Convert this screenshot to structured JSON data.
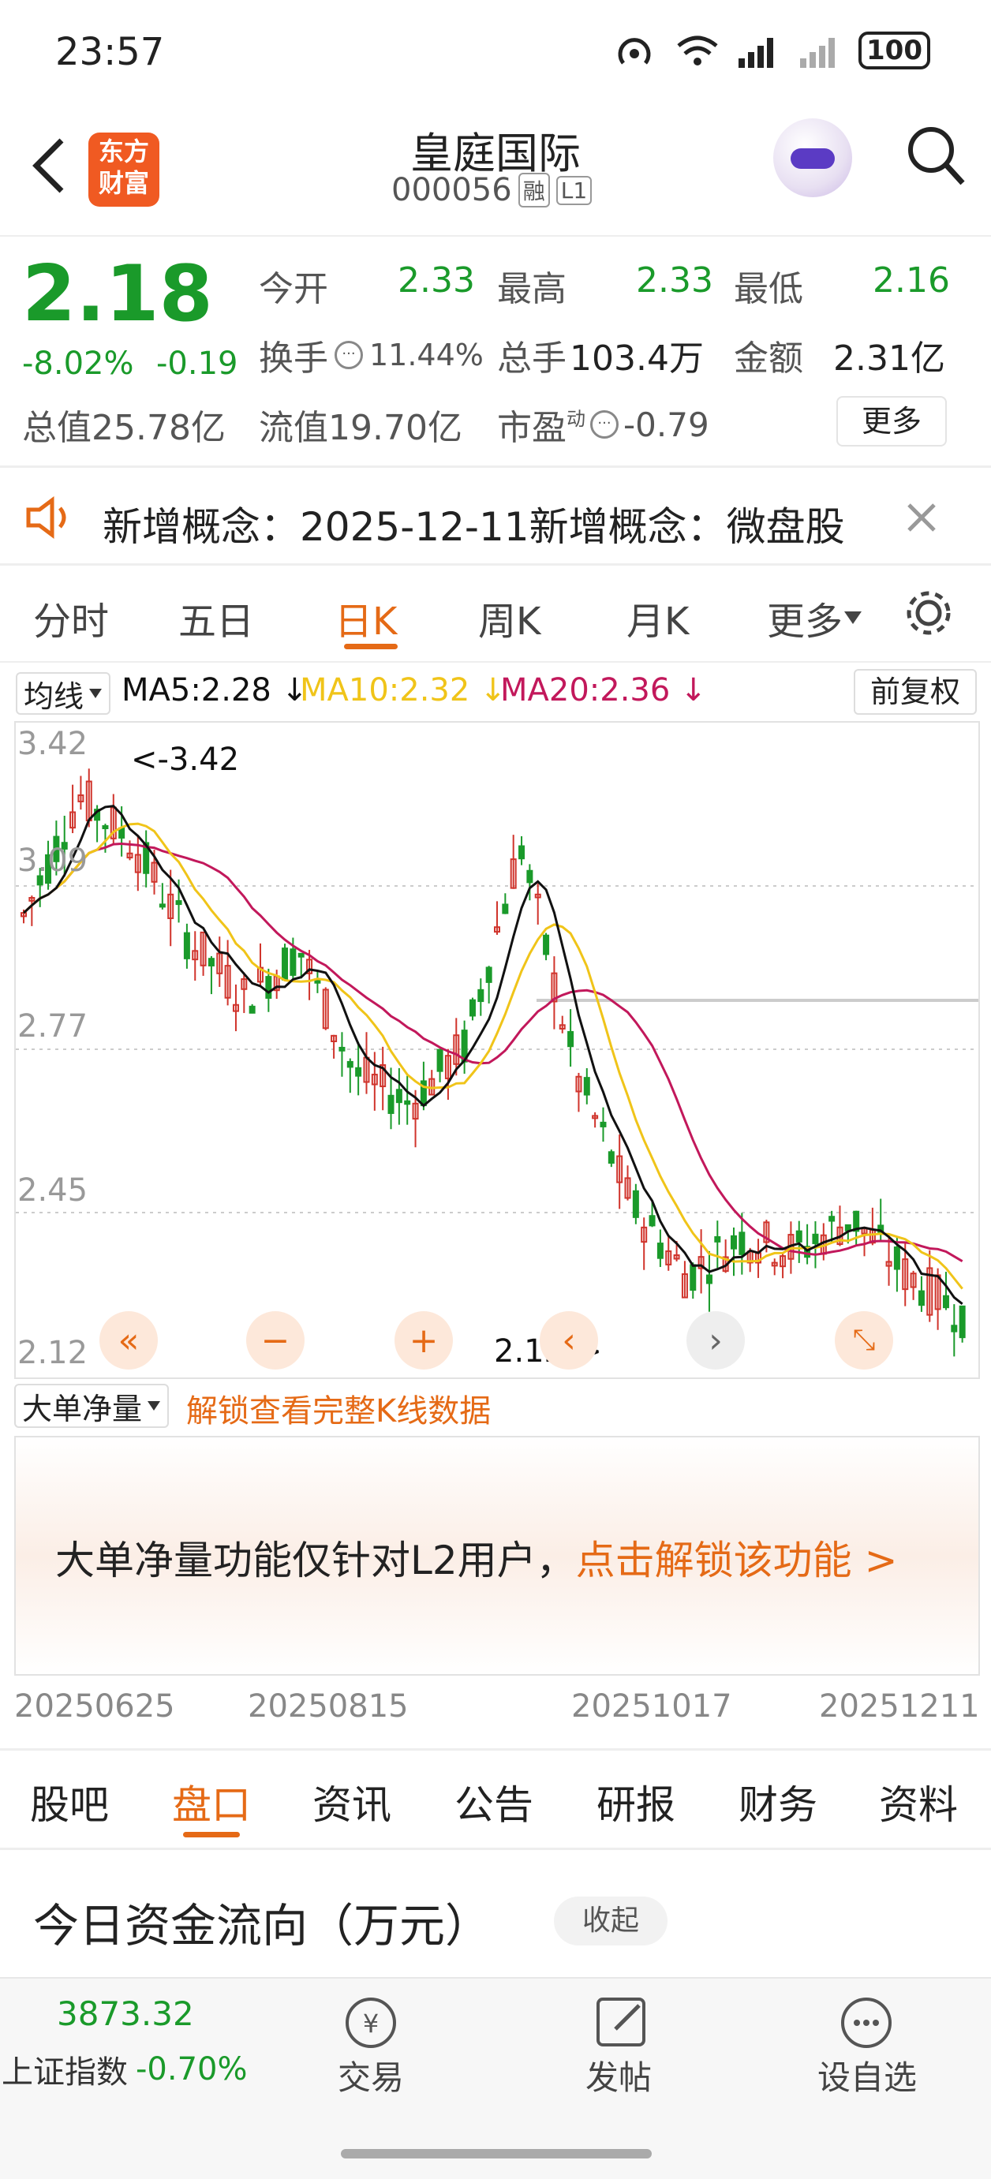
{
  "status_bar": {
    "time": "23:57",
    "battery": "100"
  },
  "header": {
    "logo_top": "东方",
    "logo_bottom": "财富",
    "title": "皇庭国际",
    "code": "000056",
    "badge_rong": "融",
    "badge_level": "L1"
  },
  "quote": {
    "price": "2.18",
    "change_pct": "-8.02%",
    "change": "-0.19",
    "open_label": "今开",
    "open": "2.33",
    "high_label": "最高",
    "high": "2.33",
    "low_label": "最低",
    "low": "2.16",
    "turnover_label": "换手",
    "turnover": "11.44%",
    "volume_label": "总手",
    "volume": "103.4万",
    "amount_label": "金额",
    "amount": "2.31亿",
    "mcap": "总值25.78亿",
    "float_mcap": "流值19.70亿",
    "pe_label": "市盈",
    "pe_sup": "动",
    "pe": "-0.79",
    "more": "更多"
  },
  "notice": {
    "text": "新增概念：2025-12-11新增概念：微盘股"
  },
  "chart_tabs": {
    "t1": "分时",
    "t2": "五日",
    "t3": "日K",
    "t4": "周K",
    "t5": "月K",
    "t6": "更多"
  },
  "indicator": {
    "selector": "均线",
    "ma5": "MA5:2.28",
    "ma10": "MA10:2.32",
    "ma20": "MA20:2.36",
    "adjust": "前复权",
    "ma5_color": "#111111",
    "ma10_color": "#f0c419",
    "ma20_color": "#c2185b"
  },
  "kline": {
    "y_ticks": [
      "3.42",
      "3.09",
      "2.77",
      "2.45",
      "2.12"
    ],
    "max_label": "<-3.42",
    "min_label": "2.12->",
    "dates": [
      "20250625",
      "20250815",
      "20251017",
      "20251211"
    ],
    "up_color": "#d0342c",
    "down_color": "#1a9a2a"
  },
  "sub_indicator": {
    "selector": "大单净量",
    "unlock_link": "解锁查看完整K线数据",
    "panel_text": "大单净量功能仅针对L2用户，",
    "panel_link": "点击解锁该功能 >"
  },
  "section_tabs": {
    "s1": "股吧",
    "s2": "盘口",
    "s3": "资讯",
    "s4": "公告",
    "s5": "研报",
    "s6": "财务",
    "s7": "资料"
  },
  "funds": {
    "title": "今日资金流向（万元）",
    "collapse": "收起"
  },
  "bottom": {
    "index_value": "3873.32",
    "index_name": "上证指数",
    "index_change": "-0.70%",
    "trade": "交易",
    "post": "发帖",
    "watch": "设自选"
  }
}
